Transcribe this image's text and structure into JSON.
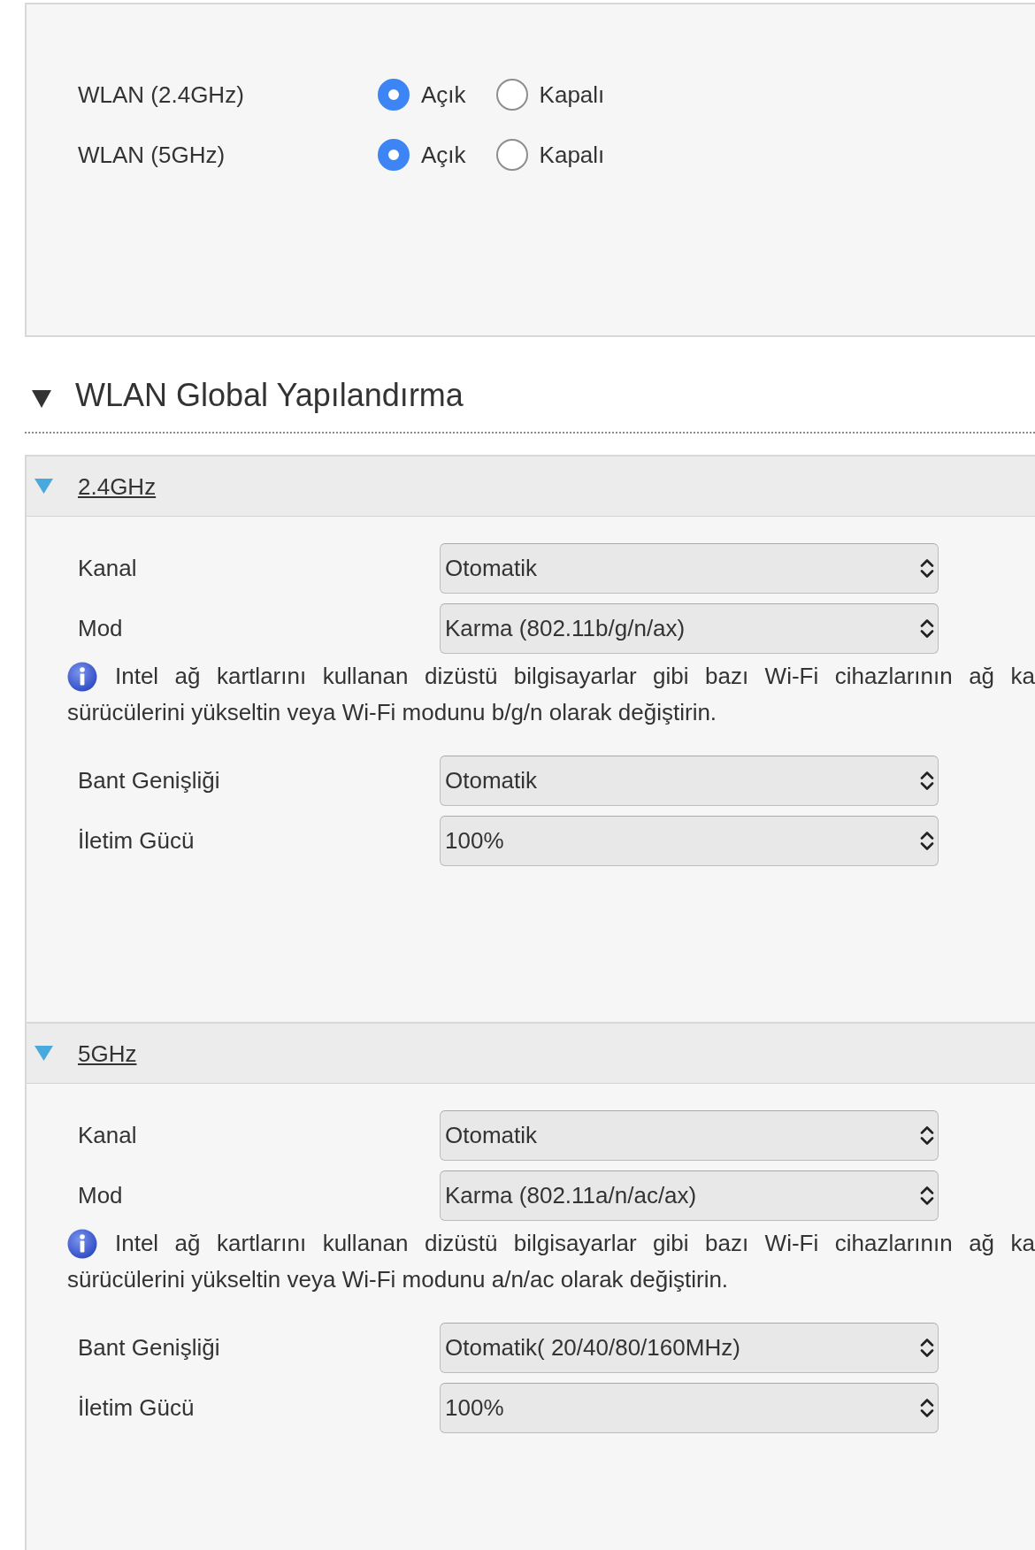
{
  "wlan_switches": [
    {
      "label": "WLAN (2.4GHz)",
      "options": [
        {
          "label": "Açık",
          "selected": true
        },
        {
          "label": "Kapalı",
          "selected": false
        }
      ]
    },
    {
      "label": "WLAN (5GHz)",
      "options": [
        {
          "label": "Açık",
          "selected": true
        },
        {
          "label": "Kapalı",
          "selected": false
        }
      ]
    }
  ],
  "section": {
    "title": "WLAN Global Yapılandırma",
    "expanded": true
  },
  "bands": [
    {
      "title": "2.4GHz",
      "expanded": true,
      "rows": [
        {
          "kind": "select",
          "label": "Kanal",
          "value": "Otomatik"
        },
        {
          "kind": "select",
          "label": "Mod",
          "value": "Karma (802.11b/g/n/ax)"
        },
        {
          "kind": "note",
          "lines": [
            "Intel ağ kartlarını kullanan dizüstü bilgisayarlar gibi bazı Wi-Fi cihazlarının ağ ka",
            "sürücülerini yükseltin veya Wi-Fi modunu b/g/n olarak değiştirin."
          ]
        },
        {
          "kind": "select",
          "label": "Bant Genişliği",
          "value": "Otomatik"
        },
        {
          "kind": "select",
          "label": "İletim Gücü",
          "value": "100%"
        }
      ]
    },
    {
      "title": "5GHz",
      "expanded": true,
      "rows": [
        {
          "kind": "select",
          "label": "Kanal",
          "value": "Otomatik"
        },
        {
          "kind": "select",
          "label": "Mod",
          "value": "Karma (802.11a/n/ac/ax)"
        },
        {
          "kind": "note",
          "lines": [
            "Intel ağ kartlarını kullanan dizüstü bilgisayarlar gibi bazı Wi-Fi cihazlarının ağ ka",
            "sürücülerini yükseltin veya Wi-Fi modunu a/n/ac olarak değiştirin."
          ]
        },
        {
          "kind": "select",
          "label": "Bant Genişliği",
          "value": "Otomatik( 20/40/80/160MHz)"
        },
        {
          "kind": "select",
          "label": "İletim Gücü",
          "value": "100%"
        }
      ]
    }
  ]
}
